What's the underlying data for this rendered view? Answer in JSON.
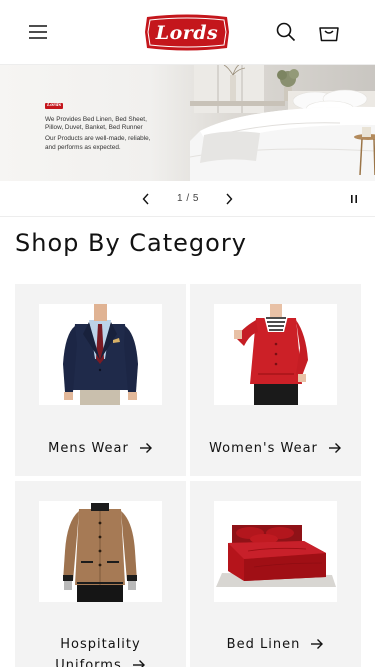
{
  "brand": {
    "logo_text": "Lords",
    "accent": "#c4161c"
  },
  "header": {
    "menu_icon": "hamburger-menu-icon",
    "search_icon": "search-icon",
    "cart_icon": "cart-icon"
  },
  "banner": {
    "logo_text": "Lords",
    "lines": [
      "We Provides Bed Linen, Bed Sheet,",
      "Pillow, Duvet, Banket, Bed Runner",
      "Our Products are well-made, reliable,",
      "and performs as expected."
    ]
  },
  "slider": {
    "counter": "1 / 5",
    "current": 1,
    "total": 5,
    "prev_icon": "chevron-left-icon",
    "next_icon": "chevron-right-icon",
    "pause_icon": "pause-icon"
  },
  "section": {
    "title": "Shop By Category"
  },
  "categories": [
    {
      "label": "Mens Wear",
      "image": "mens-suit-image"
    },
    {
      "label": "Women's Wear",
      "image": "womens-uniform-image"
    },
    {
      "label": "Hospitality Uniforms",
      "line1": "Hospitality",
      "line2": "Uniforms",
      "image": "hospitality-jacket-image"
    },
    {
      "label": "Bed Linen",
      "image": "red-bed-image"
    }
  ]
}
